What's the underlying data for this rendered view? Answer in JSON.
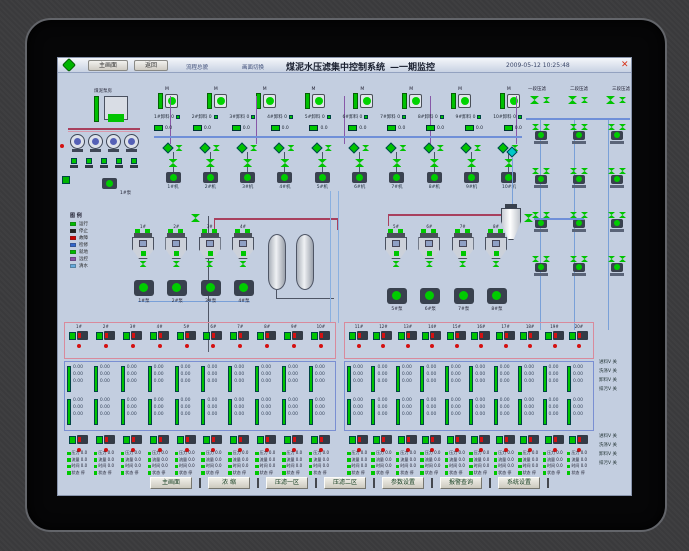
{
  "window": {
    "title": "煤泥水压滤集中控制系统",
    "subtitle": "—一期监控",
    "datetime": "2009-05-12 10:25:48",
    "close": "✕",
    "toolbar_buttons": [
      "主画面",
      "返回"
    ],
    "toolbar_labels": [
      "流程总貌",
      "画面切换"
    ]
  },
  "station": {
    "label": "煤泥泵房",
    "aux_label": "1#泵"
  },
  "agitators": [
    "M",
    "M",
    "M",
    "M",
    "M",
    "M",
    "M",
    "M"
  ],
  "readout_a": [
    "1#卸料 0",
    "2#卸料 0",
    "3#卸料 0",
    "4#卸料 0",
    "5#卸料 0",
    "6#卸料 0",
    "7#卸料 0",
    "8#卸料 0",
    "9#卸料 0",
    "10#卸料 0"
  ],
  "readout_b_value": "0.0",
  "press_columns": [
    "1#机",
    "2#机",
    "3#机",
    "4#机",
    "5#机",
    "6#机",
    "7#机",
    "8#机",
    "9#机",
    "10#机"
  ],
  "right_section": {
    "headers": [
      "一段压滤",
      "二段压滤",
      "三段压滤"
    ]
  },
  "legend": {
    "title": "图 例",
    "items": [
      {
        "color": "#00bb00",
        "label": "运行"
      },
      {
        "color": "#222222",
        "label": "停止"
      },
      {
        "color": "#cc0000",
        "label": "故障"
      },
      {
        "color": "#3366cc",
        "label": "检修"
      },
      {
        "color": "#00bb00",
        "label": "就地"
      },
      {
        "color": "#8855aa",
        "label": "远控"
      },
      {
        "color": "#66aadd",
        "label": "清水"
      }
    ]
  },
  "mid_left": {
    "hoppers": [
      "1#",
      "2#",
      "3#",
      "4#"
    ],
    "pumps": [
      "1#泵",
      "2#泵",
      "3#泵",
      "4#泵"
    ]
  },
  "mid_right": {
    "hoppers": [
      "5#",
      "6#",
      "7#",
      "8#"
    ],
    "pumps": [
      "5#泵",
      "6#泵",
      "7#泵",
      "8#泵"
    ]
  },
  "bottom": {
    "left_units": [
      "1#",
      "2#",
      "3#",
      "4#",
      "5#",
      "6#",
      "7#",
      "8#",
      "9#",
      "10#"
    ],
    "right_units": [
      "11#",
      "12#",
      "13#",
      "14#",
      "15#",
      "16#",
      "17#",
      "18#",
      "19#",
      "20#"
    ],
    "cell_lines": [
      "0.00",
      "0.00",
      "0.00"
    ],
    "ro4_lines": [
      "压力 0.0",
      "流量 0.0",
      "时间 0.0",
      "状态 停"
    ],
    "side_stack_1": [
      "进料V 关",
      "洗涤V 关",
      "卸料V 关",
      "排污V 关"
    ],
    "side_stack_2": [
      "进料V 关",
      "洗涤V 关",
      "卸料V 关",
      "排污V 关"
    ]
  },
  "counts": {
    "cols10": 10,
    "right_rows": 4
  },
  "nav_buttons": [
    "主画面",
    "浓 缩",
    "压滤一区",
    "压滤二区",
    "参数设置",
    "报警查询",
    "系统设置"
  ],
  "colors": {
    "accent_green": "#00c400",
    "alarm_red": "#d41111",
    "pipe_maroon": "#a8405e",
    "pipe_blue": "#6f8fd8"
  }
}
